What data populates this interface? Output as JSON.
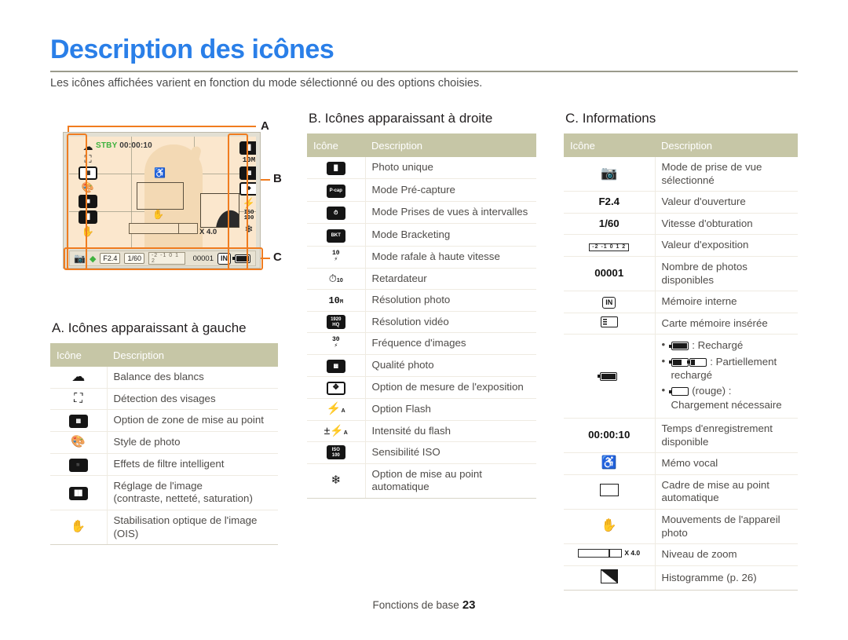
{
  "page": {
    "title": "Description des icônes",
    "intro": "Les icônes affichées varient en fonction du mode sélectionné ou des options choisies.",
    "footer_label": "Fonctions de base",
    "footer_page": "23",
    "title_color": "#2a7fe8",
    "table_header_color": "#c6c6a6",
    "callout_color": "#f07c1f"
  },
  "lcd": {
    "status_mode": "STBY",
    "status_time": "00:00:10",
    "zoom_label": "X 4.0",
    "aperture": "F2.4",
    "shutter": "1/60",
    "ev_scale": "-2 -1 0 1 2",
    "shots_remaining": "00001",
    "memory": "IN",
    "left_icons": [
      "white-balance-icon",
      "face-detection-icon",
      "focus-area-icon",
      "photo-style-icon",
      "smart-filter-icon",
      "image-adjust-icon",
      "ois-icon"
    ],
    "right_icons": [
      "single-shot-icon",
      "photo-resolution-icon",
      "photo-quality-icon",
      "metering-icon",
      "flash-auto-icon",
      "iso-icon",
      "macro-focus-icon"
    ],
    "callouts": [
      {
        "label": "A"
      },
      {
        "label": "B"
      },
      {
        "label": "C"
      }
    ]
  },
  "sectionA": {
    "title": "A. Icônes apparaissant à gauche",
    "columns": {
      "icon": "Icône",
      "description": "Description"
    },
    "rows": [
      {
        "icon": "white-balance-cloud-icon",
        "description": "Balance des blancs"
      },
      {
        "icon": "face-detection-icon",
        "description": "Détection des visages"
      },
      {
        "icon": "focus-area-grid-icon",
        "description": "Option de zone de mise au point"
      },
      {
        "icon": "photo-style-palette-icon",
        "description": "Style de photo"
      },
      {
        "icon": "smart-filter-icon",
        "description": "Effets de filtre intelligent"
      },
      {
        "icon": "image-adjust-icon",
        "description": "Réglage de l'image",
        "description2": "(contraste, netteté, saturation)"
      },
      {
        "icon": "ois-hand-icon",
        "description": "Stabilisation optique de l'image (OIS)"
      }
    ]
  },
  "sectionB": {
    "title": "B. Icônes apparaissant à droite",
    "columns": {
      "icon": "Icône",
      "description": "Description"
    },
    "rows": [
      {
        "icon": "single-shot-icon",
        "description": "Photo unique"
      },
      {
        "icon": "precapture-icon",
        "description": "Mode Pré-capture"
      },
      {
        "icon": "interval-shooting-icon",
        "description": "Mode Prises de vues à intervalles"
      },
      {
        "icon": "bracketing-icon",
        "description": "Mode Bracketing"
      },
      {
        "icon": "high-speed-burst-icon",
        "description": "Mode rafale à haute vitesse"
      },
      {
        "icon": "self-timer-icon",
        "description": "Retardateur"
      },
      {
        "icon": "photo-resolution-icon",
        "description": "Résolution photo"
      },
      {
        "icon": "video-resolution-icon",
        "description": "Résolution vidéo"
      },
      {
        "icon": "frame-rate-icon",
        "description": "Fréquence d'images"
      },
      {
        "icon": "photo-quality-icon",
        "description": "Qualité photo"
      },
      {
        "icon": "metering-icon",
        "description": "Option de mesure de l'exposition"
      },
      {
        "icon": "flash-auto-icon",
        "description": "Option Flash"
      },
      {
        "icon": "flash-intensity-icon",
        "description": "Intensité du flash"
      },
      {
        "icon": "iso-icon",
        "description": "Sensibilité ISO"
      },
      {
        "icon": "macro-focus-icon",
        "description": "Option de mise au point automatique"
      }
    ]
  },
  "sectionC": {
    "title": "C. Informations",
    "columns": {
      "icon": "Icône",
      "description": "Description"
    },
    "rows": [
      {
        "icon": "shooting-mode-icon",
        "description": "Mode de prise de vue",
        "description2": "sélectionné"
      },
      {
        "icon": "aperture-value",
        "value": "F2.4",
        "description": "Valeur d'ouverture"
      },
      {
        "icon": "shutter-speed-value",
        "value": "1/60",
        "description": "Vitesse d'obturation"
      },
      {
        "icon": "exposure-value-icon",
        "value": "-2 -1 0 1 2",
        "description": "Valeur d'exposition"
      },
      {
        "icon": "shots-remaining-value",
        "value": "00001",
        "description": "Nombre de photos disponibles"
      },
      {
        "icon": "internal-memory-icon",
        "value": "IN",
        "description": "Mémoire interne"
      },
      {
        "icon": "memory-card-icon",
        "description": "Carte mémoire insérée"
      },
      {
        "icon": "battery-icon",
        "battery_items": [
          {
            "state": "full",
            "text": ": Rechargé"
          },
          {
            "state": "partial",
            "text": ": Partiellement rechargé"
          },
          {
            "state": "empty",
            "text": "(rouge) : Chargement nécessaire"
          }
        ]
      },
      {
        "icon": "recording-time-value",
        "value": "00:00:10",
        "description": "Temps d'enregistrement",
        "description2": "disponible"
      },
      {
        "icon": "voice-memo-icon",
        "description": "Mémo vocal"
      },
      {
        "icon": "af-frame-icon",
        "description": "Cadre de mise au point",
        "description2": "automatique"
      },
      {
        "icon": "camera-shake-icon",
        "description": "Mouvements de l'appareil photo"
      },
      {
        "icon": "zoom-level-icon",
        "value": "X 4.0",
        "description": "Niveau de zoom"
      },
      {
        "icon": "histogram-icon",
        "description": "Histogramme (p. 26)"
      }
    ]
  }
}
